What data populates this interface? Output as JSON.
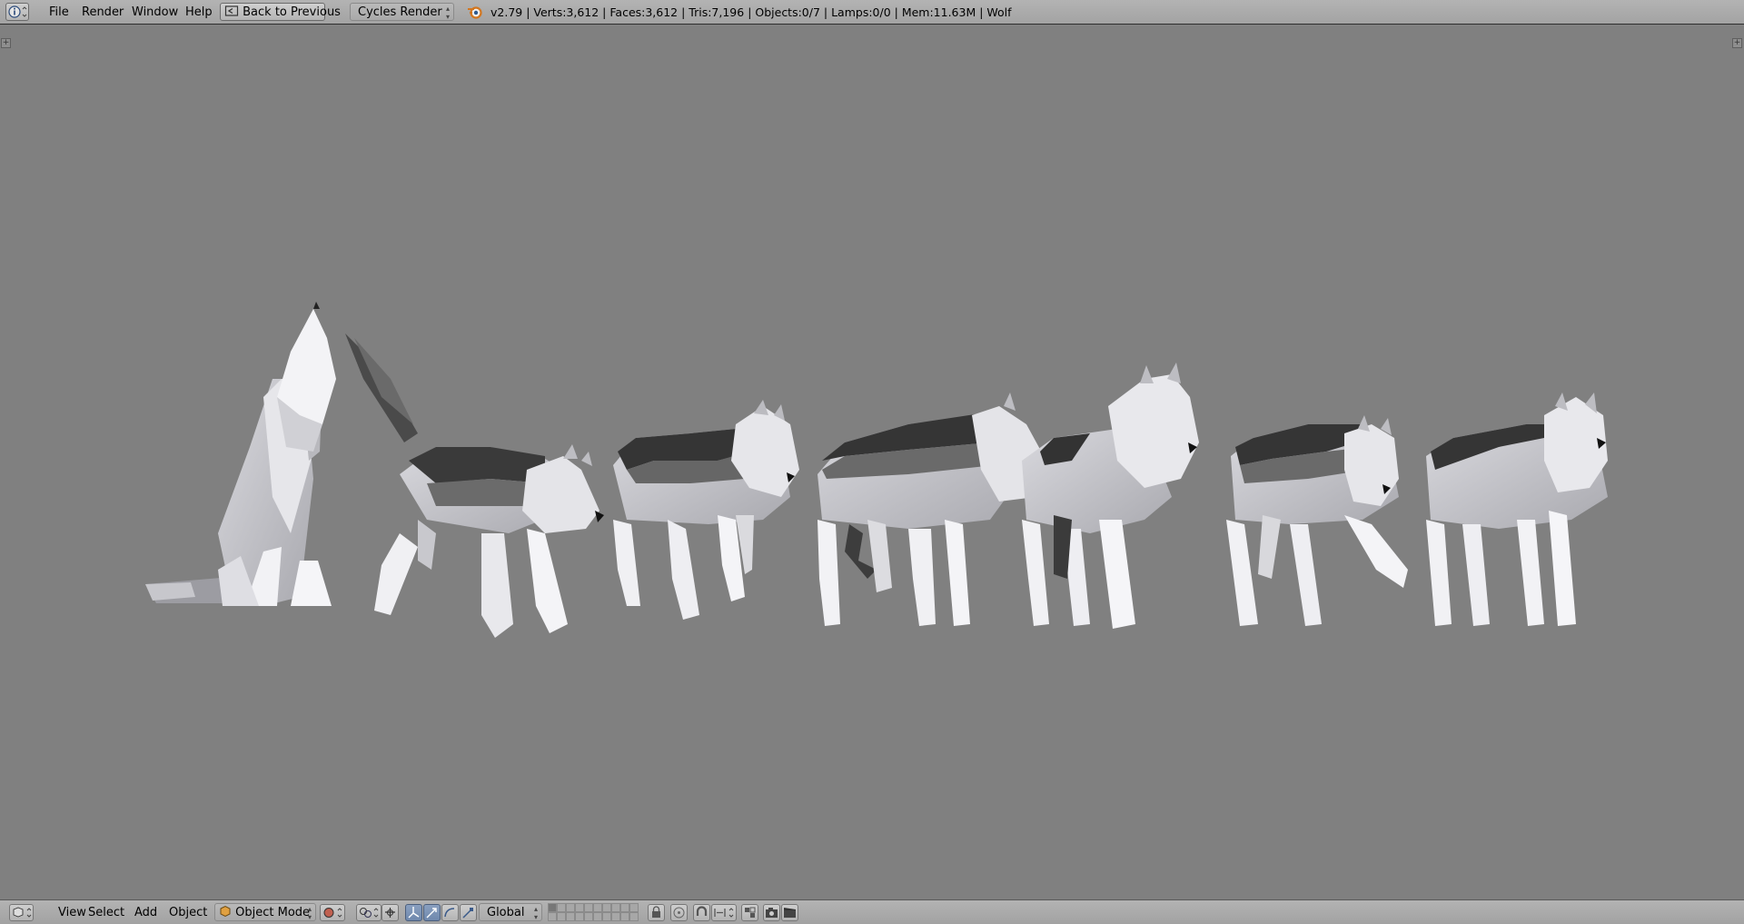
{
  "top_header": {
    "menus": [
      "File",
      "Render",
      "Window",
      "Help"
    ],
    "back_button_label": "Back to Previous",
    "render_engine": "Cycles Render",
    "stats": "v2.79 | Verts:3,612 | Faces:3,612 | Tris:7,196 | Objects:0/7 | Lamps:0/0 | Mem:11.63M | Wolf"
  },
  "viewport": {
    "background_color": "#808080",
    "objects": [
      "wolf-howling",
      "wolf-walking-1",
      "wolf-walking-2",
      "wolf-standing-1",
      "wolf-standing-2",
      "wolf-walking-3",
      "wolf-standing-3"
    ]
  },
  "bottom_header": {
    "menus": [
      "View",
      "Select",
      "Add",
      "Object"
    ],
    "mode": "Object Mode",
    "orientation": "Global"
  },
  "colors": {
    "header_bg": "#a8a8a8",
    "active_button": "#6f88ad",
    "wolf_light": "#e8e8ec",
    "wolf_mid": "#bdbdc2",
    "wolf_dark": "#3c3c3c"
  }
}
